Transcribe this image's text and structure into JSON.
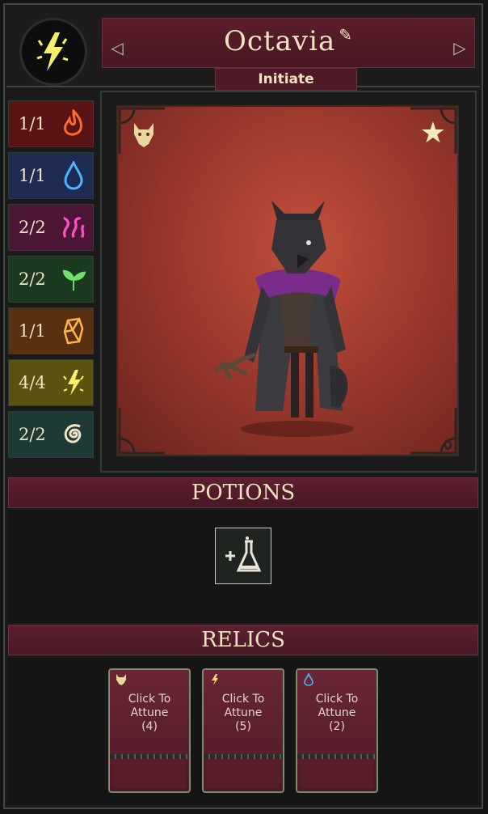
{
  "character": {
    "name": "Octavia",
    "rank": "Initiate"
  },
  "elements": [
    {
      "count": "1/1",
      "icon": "fire-icon",
      "bg": "#5b1414",
      "color": "#ff6a2a"
    },
    {
      "count": "1/1",
      "icon": "water-drop-icon",
      "bg": "#1e2b52",
      "color": "#4fb4ff"
    },
    {
      "count": "2/2",
      "icon": "tentacle-icon",
      "bg": "#4e1636",
      "color": "#ff4fc8"
    },
    {
      "count": "2/2",
      "icon": "sprout-icon",
      "bg": "#1c3a20",
      "color": "#6fe06a"
    },
    {
      "count": "1/1",
      "icon": "crystal-icon",
      "bg": "#5a3010",
      "color": "#ffb24a"
    },
    {
      "count": "4/4",
      "icon": "lightning-icon",
      "bg": "#5a5210",
      "color": "#fff06a"
    },
    {
      "count": "2/2",
      "icon": "spiral-icon",
      "bg": "#1e3a36",
      "color": "#f3e3c8"
    }
  ],
  "sections": {
    "potions_title": "POTIONS",
    "relics_title": "RELICS"
  },
  "relics": [
    {
      "line1": "Click To",
      "line2": "Attune",
      "count": "(4)",
      "icon": "wolf-head-icon",
      "icon_color": "#e8d8a0"
    },
    {
      "line1": "Click To",
      "line2": "Attune",
      "count": "(5)",
      "icon": "lightning-icon",
      "icon_color": "#f0e070"
    },
    {
      "line1": "Click To",
      "line2": "Attune",
      "count": "(2)",
      "icon": "water-drop-icon",
      "icon_color": "#4fb4ff"
    }
  ],
  "colors": {
    "accent_maroon": "#5d2030",
    "text_cream": "#efe3c0",
    "frame_green": "#3f4a3f"
  }
}
